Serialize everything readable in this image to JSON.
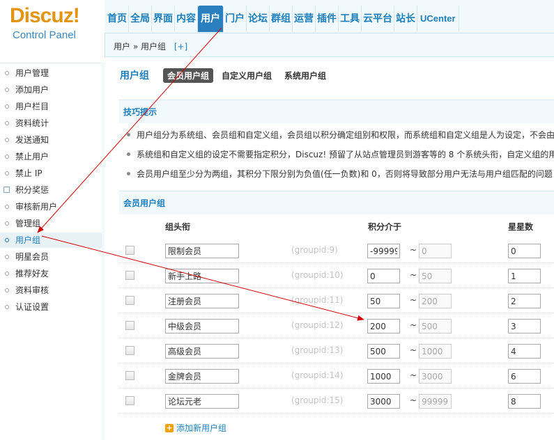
{
  "logo": {
    "main": "Discuz",
    "excl": "!",
    "sub": "Control Panel"
  },
  "topnav": [
    {
      "label": "首页"
    },
    {
      "label": "全局"
    },
    {
      "label": "界面"
    },
    {
      "label": "内容"
    },
    {
      "label": "用户",
      "active": true
    },
    {
      "label": "门户"
    },
    {
      "label": "论坛"
    },
    {
      "label": "群组"
    },
    {
      "label": "运营"
    },
    {
      "label": "插件"
    },
    {
      "label": "工具"
    },
    {
      "label": "云平台"
    },
    {
      "label": "站长"
    },
    {
      "label": "UCenter"
    }
  ],
  "breadcrumb": {
    "path": "用户 » 用户组",
    "plus": "[+]"
  },
  "sidebar": [
    {
      "label": "用户管理"
    },
    {
      "label": "添加用户"
    },
    {
      "label": "用户栏目"
    },
    {
      "label": "资料统计"
    },
    {
      "label": "发送通知"
    },
    {
      "label": "禁止用户"
    },
    {
      "label": "禁止 IP"
    },
    {
      "label": "积分奖惩"
    },
    {
      "label": "审核新用户"
    },
    {
      "label": "管理组"
    },
    {
      "label": "用户组",
      "active": true
    },
    {
      "label": "明星会员"
    },
    {
      "label": "推荐好友"
    },
    {
      "label": "资料审核"
    },
    {
      "label": "认证设置"
    }
  ],
  "main": {
    "title": "用户组",
    "tabs": [
      {
        "label": "会员用户组",
        "active": true
      },
      {
        "label": "自定义用户组"
      },
      {
        "label": "系统用户组"
      }
    ],
    "tips_title": "技巧提示",
    "tips": [
      "用户组分为系统组、会员组和自定义组，会员组以积分确定组别和权限，而系统组和自定义组是人为设定，不会由",
      "系统组和自定义组的设定不需要指定积分，Discuz! 预留了从站点管理员到游客等的 8 个系统头衔，自定义组的用",
      "会员用户组至少分为两组，其积分下限分别为负值(任一负数)和 0，否则将导致部分用户无法与用户组匹配的问题"
    ],
    "section_title": "会员用户组",
    "columns": {
      "name": "组头衔",
      "points": "积分介于",
      "stars": "星星数"
    },
    "rows": [
      {
        "name": "限制会员",
        "gid": "(groupid:9)",
        "low": "-99999",
        "high": "0",
        "stars": "0"
      },
      {
        "name": "新手上路",
        "gid": "(groupid:10)",
        "low": "0",
        "high": "50",
        "stars": "1"
      },
      {
        "name": "注册会员",
        "gid": "(groupid:11)",
        "low": "50",
        "high": "200",
        "stars": "2"
      },
      {
        "name": "中级会员",
        "gid": "(groupid:12)",
        "low": "200",
        "high": "500",
        "stars": "3"
      },
      {
        "name": "高级会员",
        "gid": "(groupid:13)",
        "low": "500",
        "high": "1000",
        "stars": "4"
      },
      {
        "name": "金牌会员",
        "gid": "(groupid:14)",
        "low": "1000",
        "high": "3000",
        "stars": "6"
      },
      {
        "name": "论坛元老",
        "gid": "(groupid:15)",
        "low": "3000",
        "high": "99999",
        "stars": "8"
      }
    ],
    "tilde": "~",
    "add_label": "添加新用户组"
  },
  "colors": {
    "accent": "#1b7fbd",
    "nav_active": "#2b7fbf",
    "logo": "#e39411",
    "annotation": "#d40000"
  }
}
